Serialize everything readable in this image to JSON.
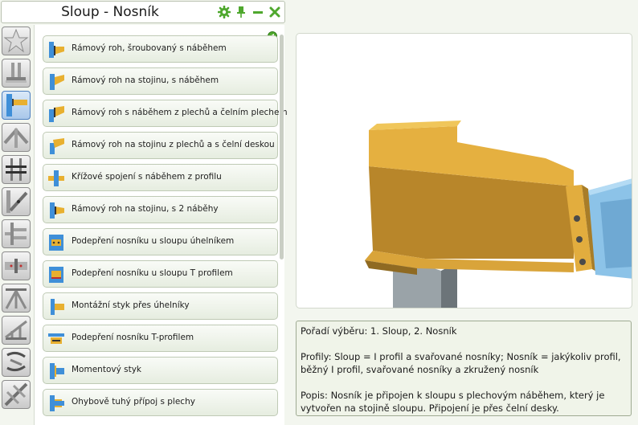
{
  "window": {
    "title": "Sloup - Nosník"
  },
  "toolbar": {
    "icons": [
      "gear-icon",
      "pin-icon",
      "minimize-icon",
      "close-icon"
    ],
    "accent": "#4fa82e"
  },
  "categories": [
    {
      "name": "favorites"
    },
    {
      "name": "base-plate"
    },
    {
      "name": "column-beam",
      "active": true
    },
    {
      "name": "apex"
    },
    {
      "name": "beam-splice"
    },
    {
      "name": "bracing"
    },
    {
      "name": "beam-beam"
    },
    {
      "name": "end-plate"
    },
    {
      "name": "truss"
    },
    {
      "name": "truss-node"
    },
    {
      "name": "purlin"
    },
    {
      "name": "diagonal"
    }
  ],
  "connections": [
    {
      "label": "Rámový roh, šroubovaný s náběhem"
    },
    {
      "label": "Rámový roh na stojinu, s náběhem"
    },
    {
      "label": "Rámový roh s náběhem z plechů a čelním plechem"
    },
    {
      "label": "Rámový roh na stojinu z plechů a s čelní deskou"
    },
    {
      "label": "Křížové spojení s náběhem z profilu"
    },
    {
      "label": "Rámový roh na stojinu, s 2 náběhy"
    },
    {
      "label": "Podepření nosníku u sloupu úhelníkem"
    },
    {
      "label": "Podepření nosníku u sloupu T profilem"
    },
    {
      "label": "Montážní styk přes úhelníky"
    },
    {
      "label": "Podepření nosníku T-profilem"
    },
    {
      "label": "Momentový styk"
    },
    {
      "label": "Ohybově tuhý přípoj s plechy"
    }
  ],
  "description": {
    "selection_order": "Pořadí výběru: 1. Sloup, 2. Nosník",
    "profiles": "Profily: Sloup = I profil a svařované nosníky; Nosník = jakýkoliv profil, běžný I profil, svařované nosníky a zkružený nosník",
    "summary": "Popis: Nosník je připojen k sloupu s plechovým náběhem, který je vytvořen na stojině sloupu. Připojení je přes čelní desky."
  }
}
